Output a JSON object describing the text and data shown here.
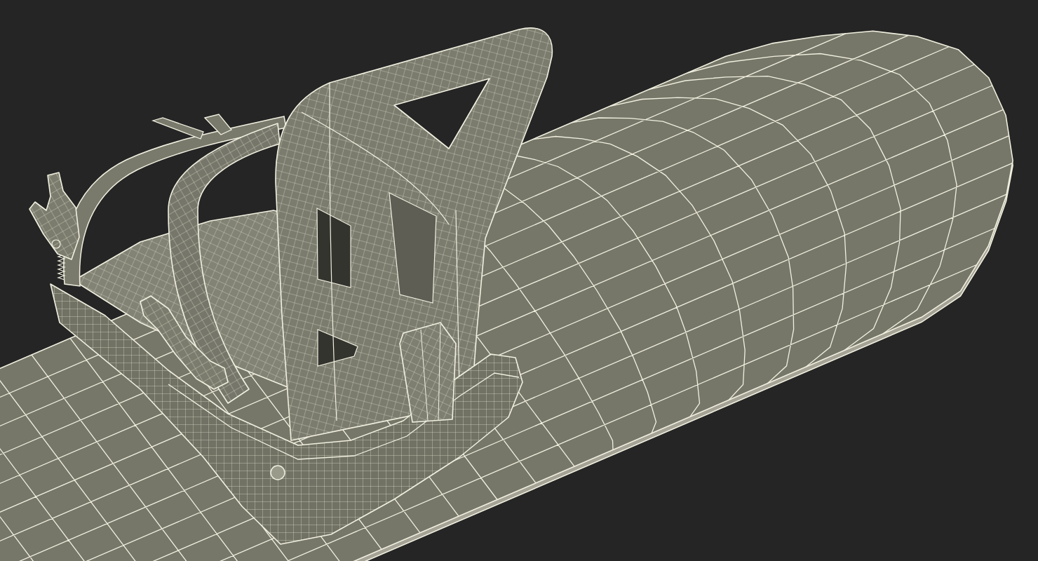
{
  "scene": {
    "objects": [
      {
        "kind": "snowboard"
      },
      {
        "kind": "binding"
      }
    ]
  }
}
